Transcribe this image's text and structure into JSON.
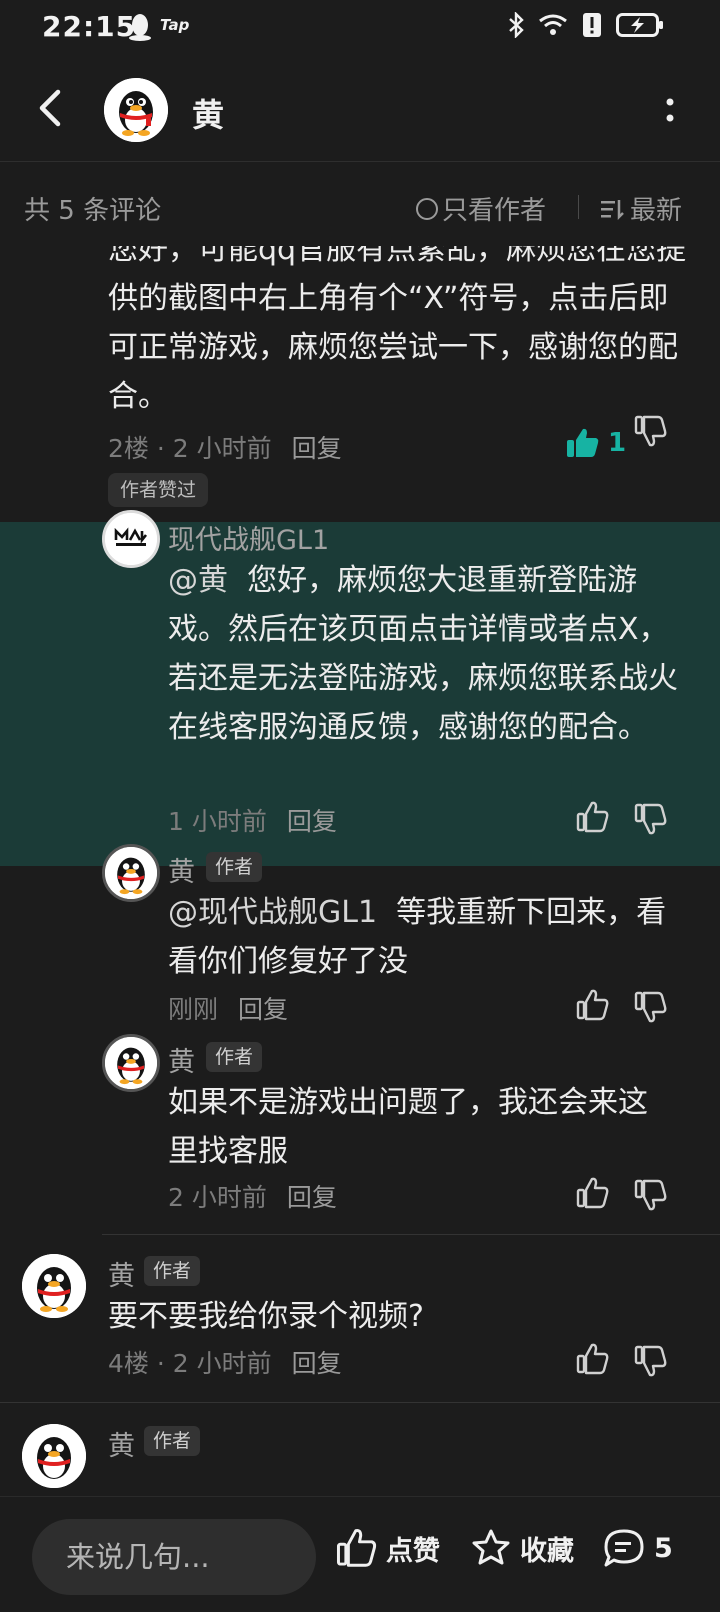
{
  "status_bar": {
    "time": "22:15",
    "tap_label": "Tap"
  },
  "header": {
    "title": "黄"
  },
  "filter": {
    "count": "共 5 条评论",
    "only_author": "只看作者",
    "sort": "最新"
  },
  "comments": [
    {
      "text": "您好，可能qq官服有点紊乱，麻烦您在您提供的截图中右上角有个“X”符号，点击后即可正常游戏，麻烦您尝试一下，感谢您的配合。",
      "meta": "2楼 · 2 小时前",
      "reply": "回复",
      "likes": "1",
      "badge": "作者赞过"
    }
  ],
  "replies": [
    {
      "name": "现代战舰GL1",
      "mention": "@黄",
      "text": "您好，麻烦您大退重新登陆游戏。然后在该页面点击详情或者点X，若还是无法登陆游戏，麻烦您联系战火在线客服沟通反馈，感谢您的配合。",
      "time": "1 小时前",
      "reply": "回复"
    },
    {
      "name": "黄",
      "badge": "作者",
      "mention": "@现代战舰GL1",
      "text": "等我重新下回来，看看你们修复好了没",
      "time": "刚刚",
      "reply": "回复"
    },
    {
      "name": "黄",
      "badge": "作者",
      "text": "如果不是游戏出问题了，我还会来这里找客服",
      "time": "2 小时前",
      "reply": "回复"
    }
  ],
  "floor4": {
    "name": "黄",
    "badge": "作者",
    "text": "要不要我给你录个视频?",
    "meta": "4楼 · 2 小时前",
    "reply": "回复"
  },
  "floor5": {
    "name": "黄",
    "badge": "作者"
  },
  "bottom": {
    "placeholder": "来说几句...",
    "like": "点赞",
    "collect": "收藏",
    "comments": "5"
  },
  "colors": {
    "accent": "#17b3a3",
    "highlight": "#1b3b37",
    "background": "#1c1c1c"
  }
}
